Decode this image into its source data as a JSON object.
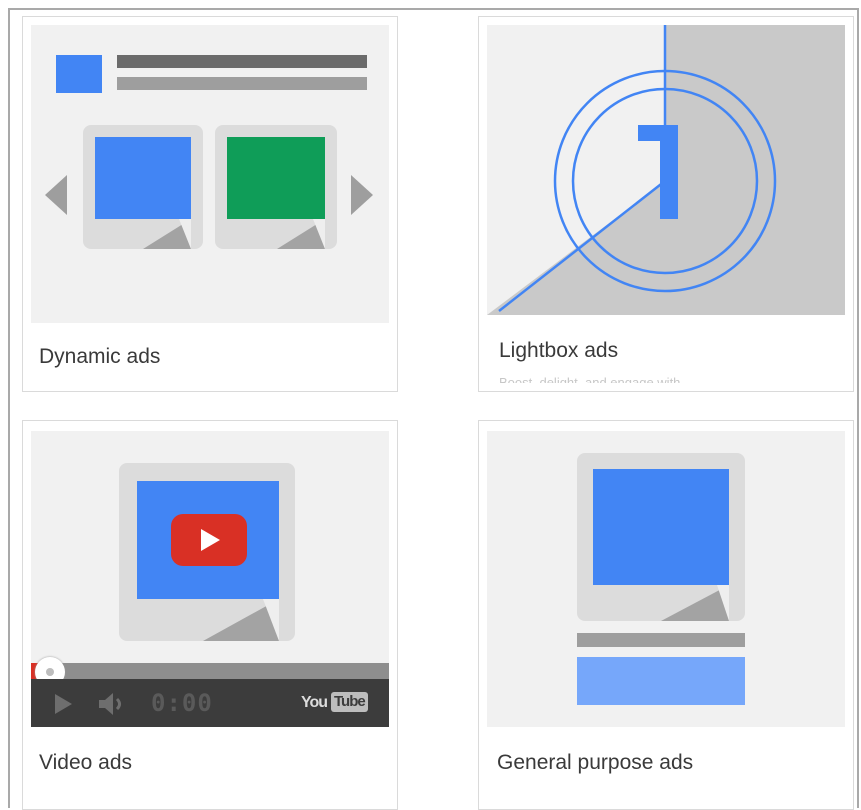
{
  "cards": [
    {
      "title": "Dynamic ads"
    },
    {
      "title": "Lightbox ads",
      "subtitle": "Boost, delight, and engage with"
    },
    {
      "title": "Video ads"
    },
    {
      "title": "General purpose ads"
    }
  ],
  "video_player": {
    "time": "0:00",
    "brand_you": "You",
    "brand_tube": "Tube",
    "progress": 0
  },
  "lightbox": {
    "countdown_number": "1"
  },
  "colors": {
    "blue": "#4285f4",
    "green": "#0f9d58",
    "red": "#d93025",
    "thumb_bg": "#f1f1f1",
    "paper": "#dcdcdc",
    "player_bar": "#3c3c3c",
    "light_blue": "#76a7fa"
  }
}
